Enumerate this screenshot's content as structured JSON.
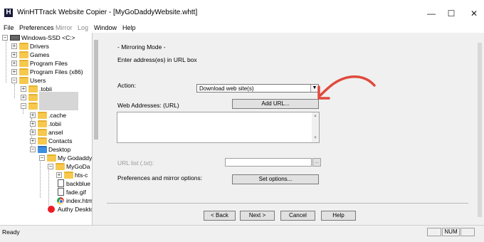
{
  "window": {
    "title": "WinHTTrack Website Copier - [MyGoDaddyWebsite.whtt]",
    "minimize": "—",
    "maximize": "☐",
    "close": "✕"
  },
  "menu": [
    "File",
    "Preferences",
    "Mirror",
    "Log",
    "Window",
    "Help"
  ],
  "tree": {
    "root": "Windows-SSD <C:>",
    "items": [
      "Drivers",
      "Games",
      "Program Files",
      "Program Files (x86)",
      "Users",
      ".tobii",
      ".cache",
      ".tobii",
      "ansel",
      "Contacts",
      "Desktop",
      "My Godaddy",
      "MyGoDa",
      "hts-c",
      "backblue",
      "fade.gif",
      "index.htm",
      "Authy Deskto"
    ]
  },
  "wizard": {
    "mode_label": "- Mirroring Mode -",
    "instruction": "Enter address(es) in URL box",
    "action_label": "Action:",
    "action_value": "Download web site(s)",
    "web_addresses_label": "Web Addresses: (URL)",
    "add_url_button": "Add URL...",
    "url_list_label": "URL list (.txt):",
    "url_browse": "...",
    "preferences_label": "Preferences and mirror options:",
    "set_options_button": "Set options...",
    "back_button": "< Back",
    "next_button": "Next >",
    "cancel_button": "Cancel",
    "help_button": "Help"
  },
  "status": {
    "text": "Ready",
    "num": "NUM"
  },
  "colors": {
    "annotation_arrow": "#e04a3c"
  }
}
